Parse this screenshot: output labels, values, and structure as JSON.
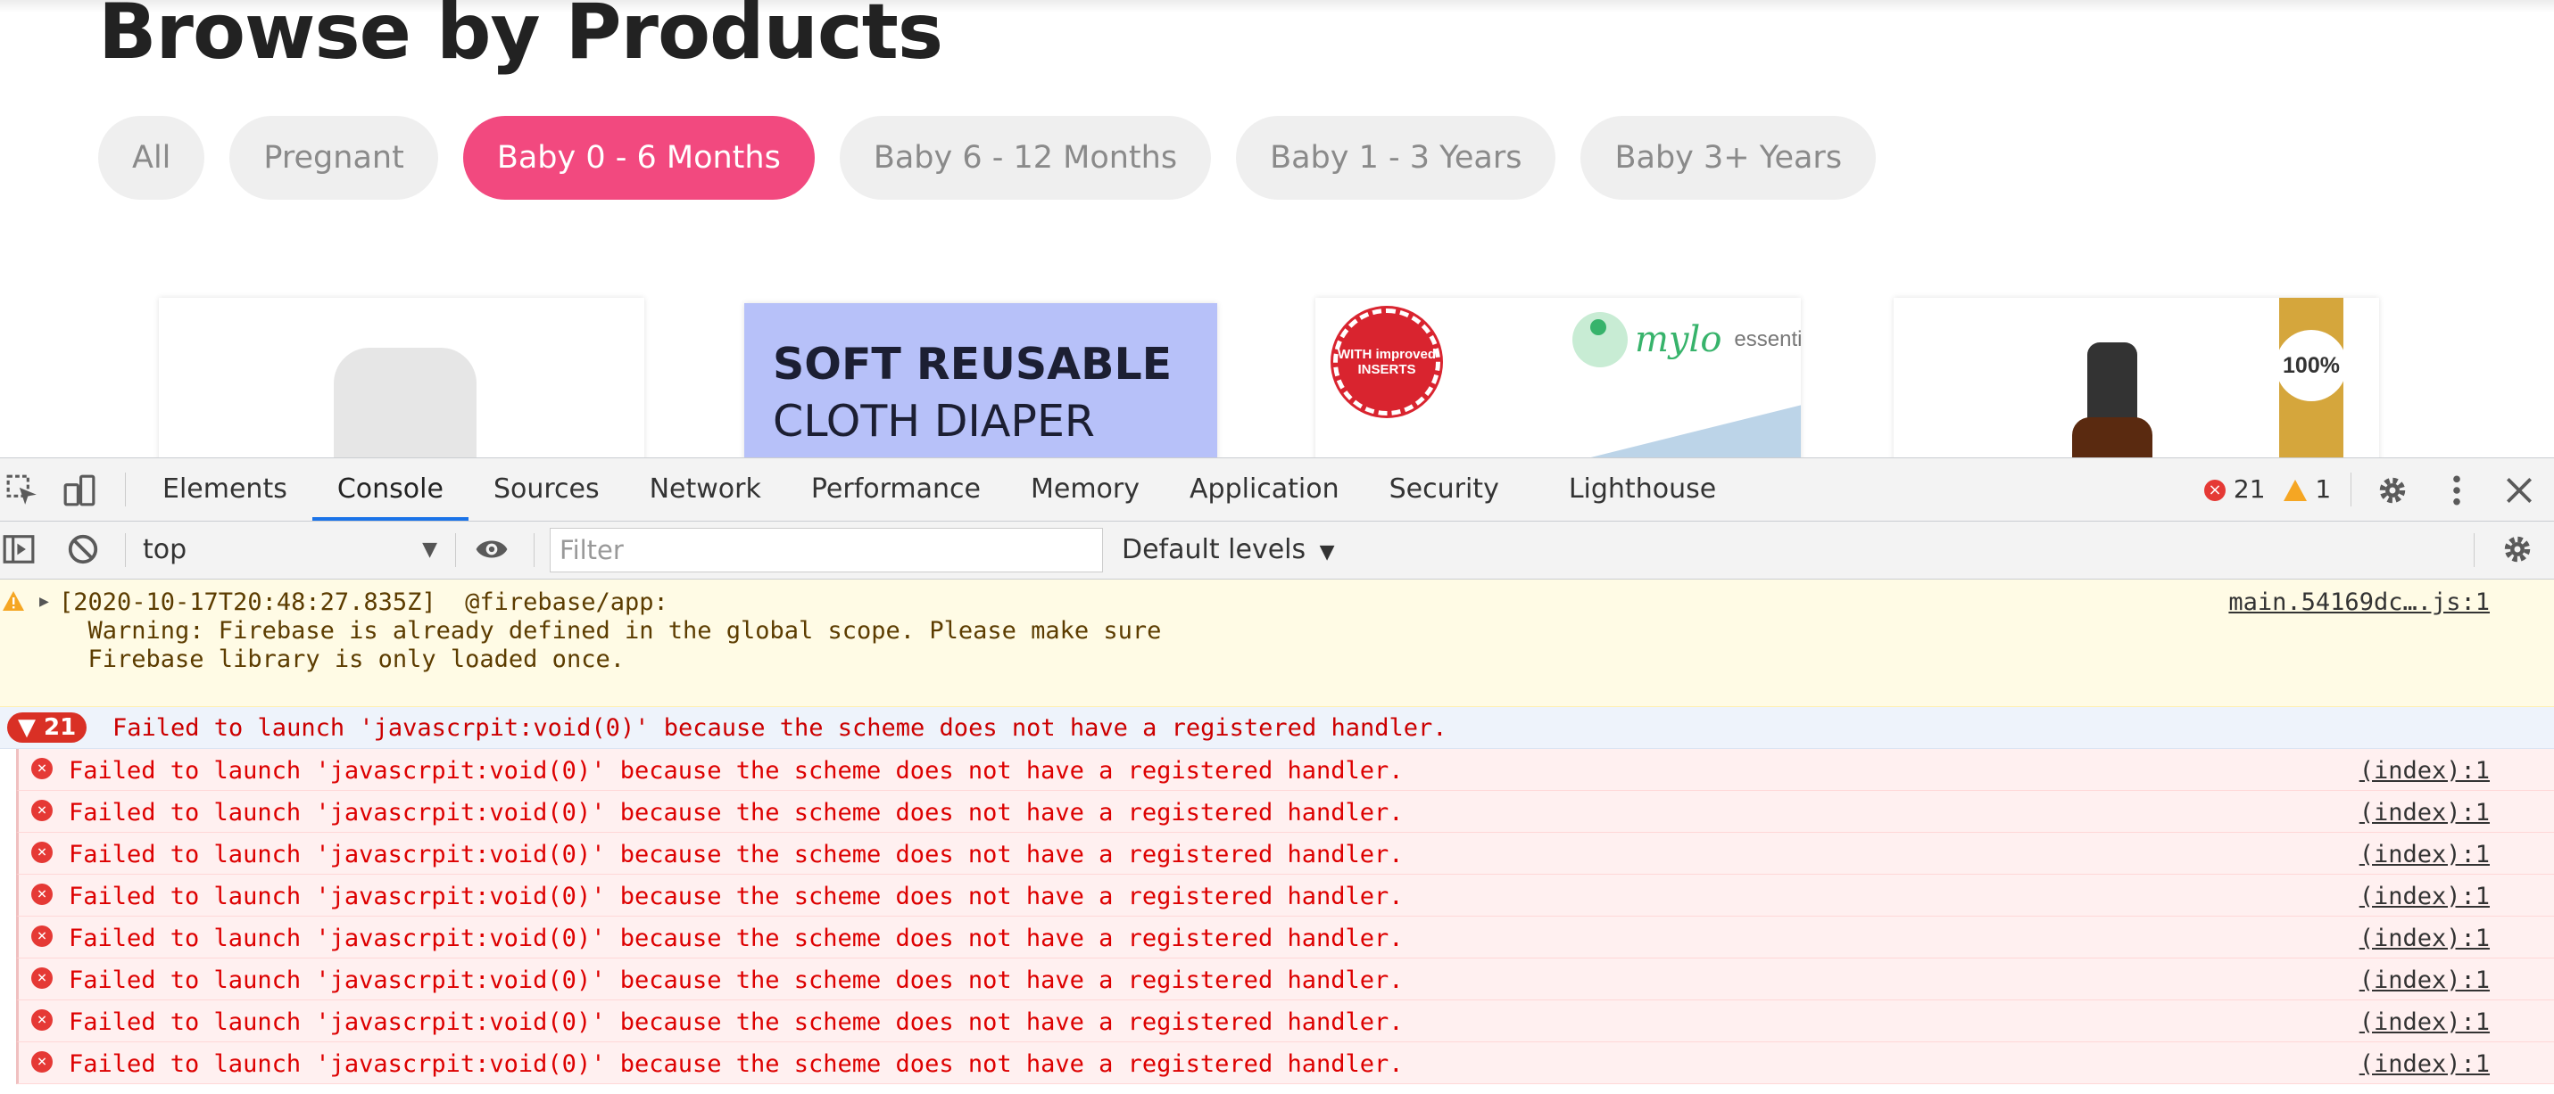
{
  "page": {
    "title": "Browse by Products",
    "chips": [
      "All",
      "Pregnant",
      "Baby 0 - 6 Months",
      "Baby 6 - 12 Months",
      "Baby 1 - 3 Years",
      "Baby 3+ Years"
    ],
    "active_chip": "Baby 0 - 6 Months",
    "cards": {
      "diaper_line1": "SOFT REUSABLE",
      "diaper_line2": "CLOTH DIAPER",
      "seal_text": "WITH improved INSERTS",
      "brand": "mylo",
      "brand_suffix": "essentials",
      "badge": "100%"
    },
    "colors": {
      "active_chip": "#f2497f",
      "diaper_bg": "#b7c1f9",
      "gold": "#d5a63c"
    }
  },
  "devtools": {
    "tabs": [
      "Elements",
      "Console",
      "Sources",
      "Network",
      "Performance",
      "Memory",
      "Application",
      "Security",
      "Lighthouse"
    ],
    "active_tab": "Console",
    "error_count": "21",
    "warning_count": "1",
    "context": "top",
    "filter_placeholder": "Filter",
    "levels_label": "Default levels",
    "warning": {
      "line1": "[2020-10-17T20:48:27.835Z]  @firebase/app:",
      "line2": "  Warning: Firebase is already defined in the global scope. Please make sure",
      "line3": "  Firebase library is only loaded once.",
      "source": "main.54169dc….js:1"
    },
    "group": {
      "count": "21",
      "message": "Failed to launch 'javascrpit:void(0)' because the scheme does not have a registered handler."
    },
    "errors": [
      {
        "message": "Failed to launch 'javascrpit:void(0)' because the scheme does not have a registered handler.",
        "source": "(index):1"
      },
      {
        "message": "Failed to launch 'javascrpit:void(0)' because the scheme does not have a registered handler.",
        "source": "(index):1"
      },
      {
        "message": "Failed to launch 'javascrpit:void(0)' because the scheme does not have a registered handler.",
        "source": "(index):1"
      },
      {
        "message": "Failed to launch 'javascrpit:void(0)' because the scheme does not have a registered handler.",
        "source": "(index):1"
      },
      {
        "message": "Failed to launch 'javascrpit:void(0)' because the scheme does not have a registered handler.",
        "source": "(index):1"
      },
      {
        "message": "Failed to launch 'javascrpit:void(0)' because the scheme does not have a registered handler.",
        "source": "(index):1"
      },
      {
        "message": "Failed to launch 'javascrpit:void(0)' because the scheme does not have a registered handler.",
        "source": "(index):1"
      },
      {
        "message": "Failed to launch 'javascrpit:void(0)' because the scheme does not have a registered handler.",
        "source": "(index):1"
      }
    ]
  }
}
